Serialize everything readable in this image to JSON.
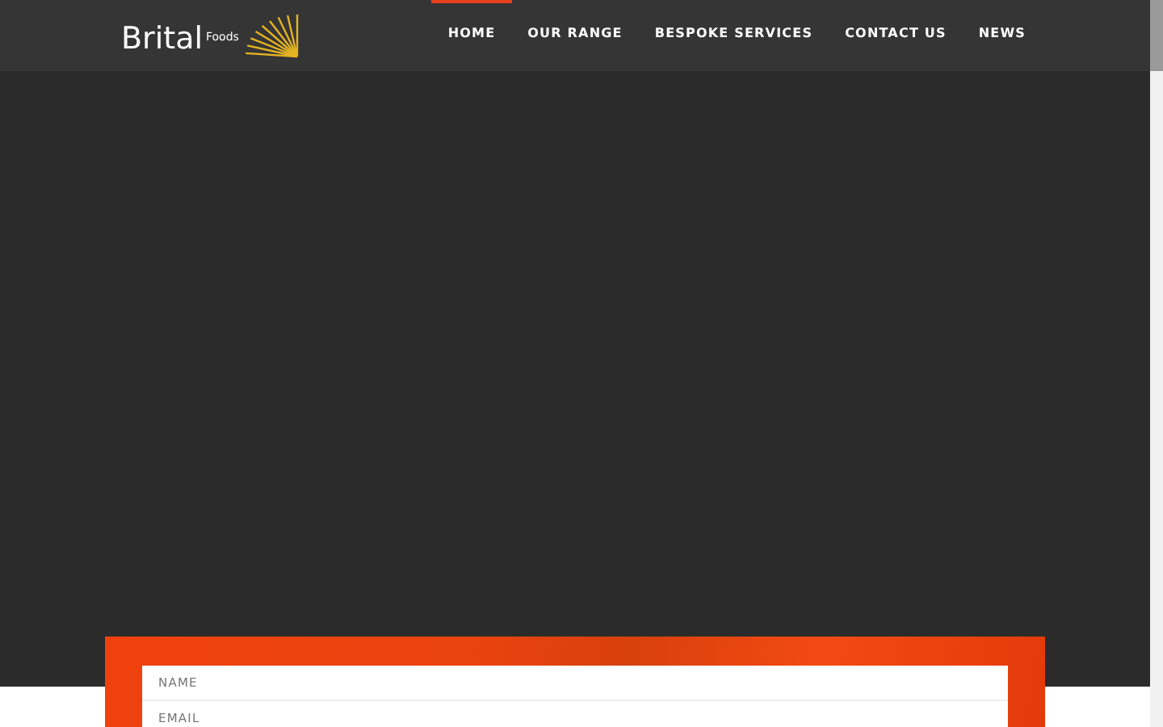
{
  "logo": {
    "name": "Brital",
    "suffix": "Foods"
  },
  "nav": [
    {
      "label": "HOME",
      "selected": true
    },
    {
      "label": "OUR RANGE",
      "selected": false
    },
    {
      "label": "BESPOKE SERVICES",
      "selected": false
    },
    {
      "label": "CONTACT US",
      "selected": false
    },
    {
      "label": "NEWS",
      "selected": false
    }
  ],
  "form": {
    "fields": [
      {
        "placeholder": "NAME"
      },
      {
        "placeholder": "EMAIL"
      }
    ]
  }
}
